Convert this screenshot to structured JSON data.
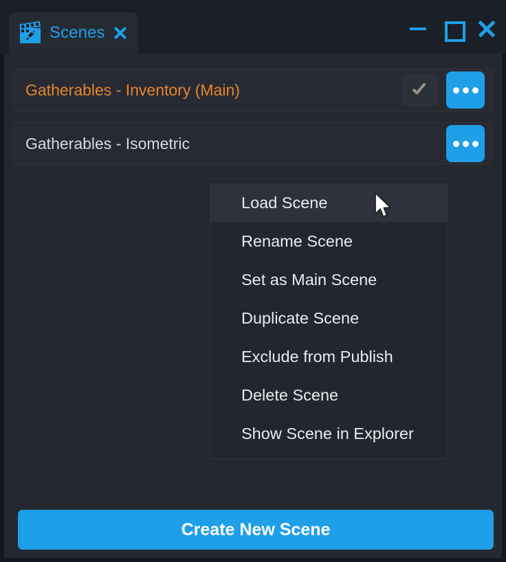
{
  "window": {
    "tab": {
      "title": "Scenes",
      "icon": "clapperboard-rocket-icon",
      "close_label": "x"
    },
    "controls": {
      "minimize": "minimize-icon",
      "maximize": "maximize-icon",
      "close": "close-icon"
    },
    "accent_color": "#1f9fe8",
    "main_scene_color": "#e8862a",
    "panel_bg": "#25282f",
    "titlebar_bg": "#1b1f27"
  },
  "scenes": [
    {
      "name": "Gatherables - Inventory (Main)",
      "is_main": true,
      "has_check": true,
      "check_icon": "checkmark-icon",
      "menu_icon": "ellipsis-icon"
    },
    {
      "name": "Gatherables - Isometric",
      "is_main": false,
      "has_check": false,
      "menu_icon": "ellipsis-icon"
    }
  ],
  "context_menu": {
    "highlighted_index": 0,
    "items": [
      {
        "label": "Load Scene"
      },
      {
        "label": "Rename Scene"
      },
      {
        "label": "Set as Main Scene"
      },
      {
        "label": "Duplicate Scene"
      },
      {
        "label": "Exclude from Publish"
      },
      {
        "label": "Delete Scene"
      },
      {
        "label": "Show Scene in Explorer"
      }
    ]
  },
  "footer": {
    "create_label": "Create New Scene"
  }
}
